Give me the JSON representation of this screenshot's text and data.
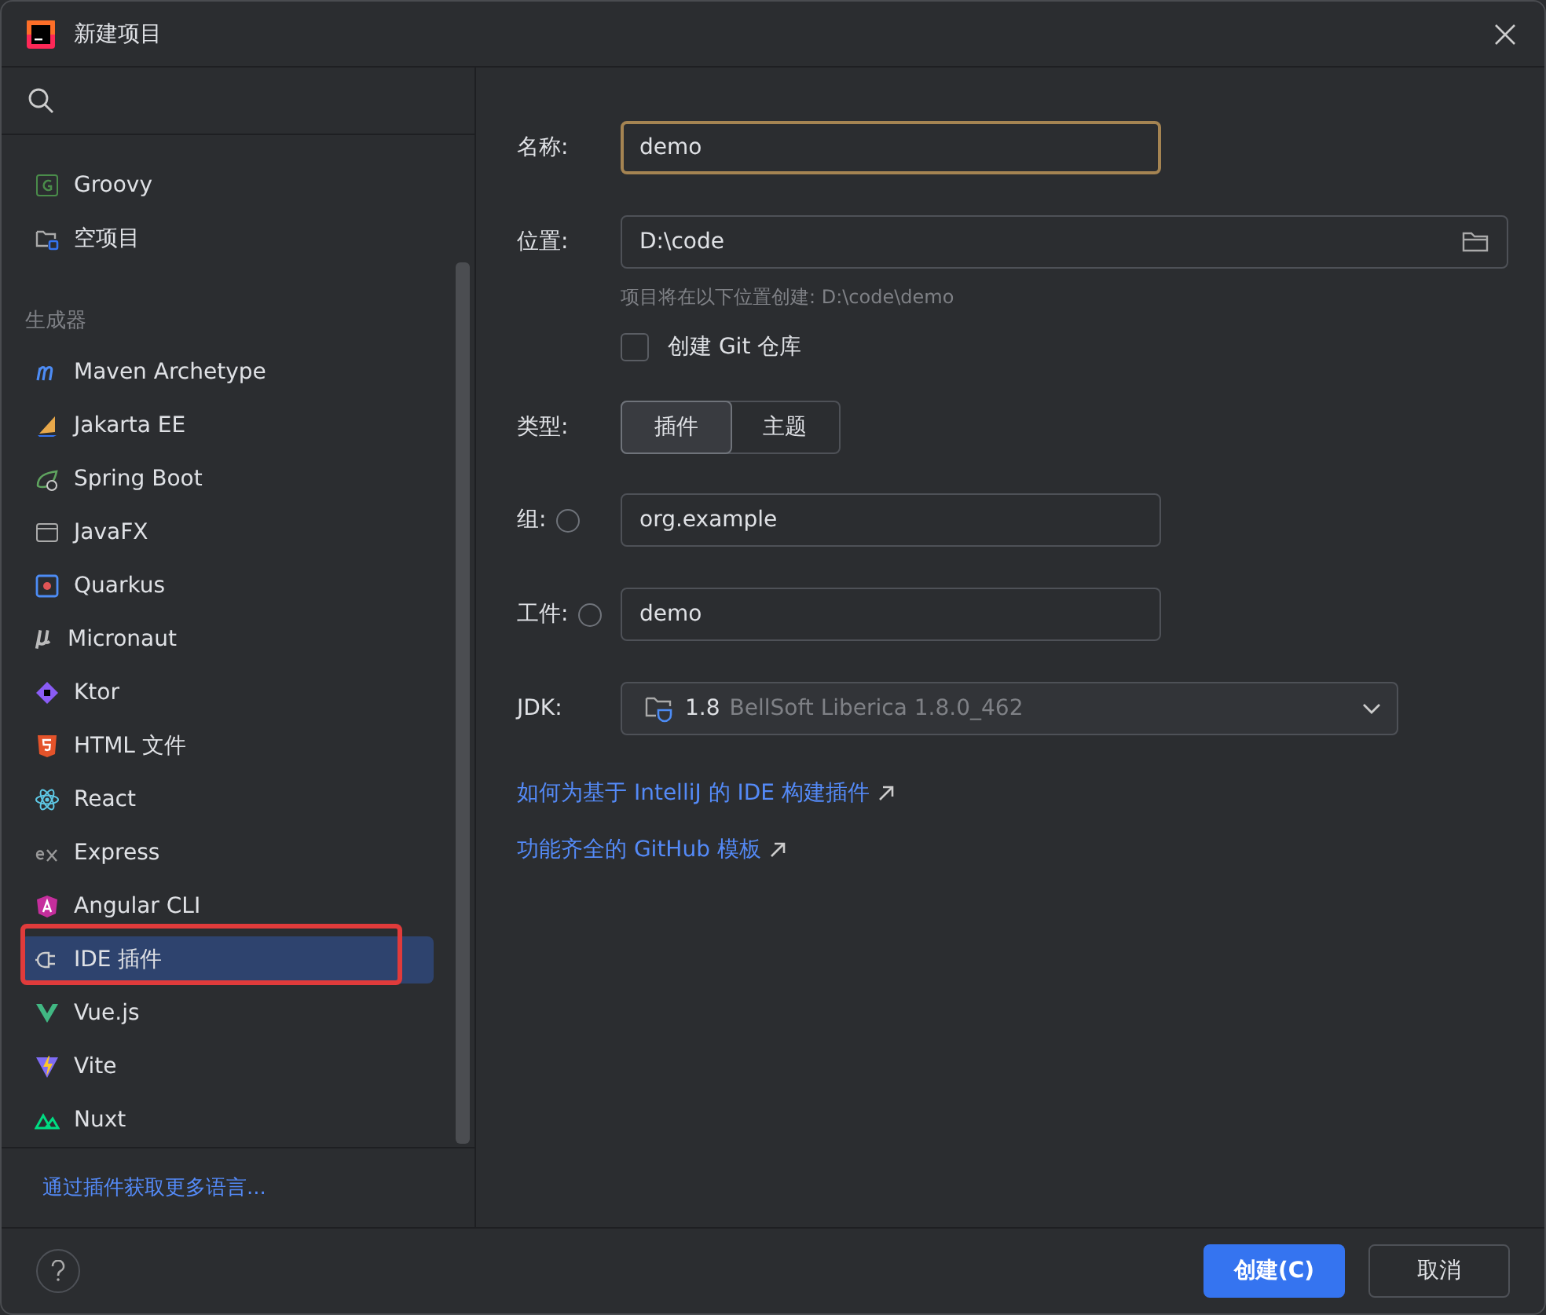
{
  "window": {
    "title": "新建项目"
  },
  "sidebar": {
    "groups": [
      {
        "items": [
          {
            "label": "Groovy",
            "selected": false
          },
          {
            "label": "空项目",
            "selected": false
          }
        ]
      },
      {
        "header": "生成器",
        "items": [
          {
            "label": "Maven Archetype",
            "selected": false
          },
          {
            "label": "Jakarta EE",
            "selected": false
          },
          {
            "label": "Spring Boot",
            "selected": false
          },
          {
            "label": "JavaFX",
            "selected": false
          },
          {
            "label": "Quarkus",
            "selected": false
          },
          {
            "label": "Micronaut",
            "selected": false
          },
          {
            "label": "Ktor",
            "selected": false
          },
          {
            "label": "HTML 文件",
            "selected": false
          },
          {
            "label": "React",
            "selected": false
          },
          {
            "label": "Express",
            "selected": false
          },
          {
            "label": "Angular CLI",
            "selected": false
          },
          {
            "label": "IDE 插件",
            "selected": true
          },
          {
            "label": "Vue.js",
            "selected": false
          },
          {
            "label": "Vite",
            "selected": false
          },
          {
            "label": "Nuxt",
            "selected": false
          }
        ]
      }
    ],
    "footer_link": "通过插件获取更多语言..."
  },
  "form": {
    "name": {
      "label": "名称:",
      "value": "demo",
      "focused": true
    },
    "location": {
      "label": "位置:",
      "value": "D:\\code",
      "hint": "项目将在以下位置创建: D:\\code\\demo"
    },
    "git": {
      "label": "创建 Git 仓库",
      "checked": false
    },
    "type": {
      "label": "类型:",
      "options": [
        {
          "label": "插件",
          "selected": true
        },
        {
          "label": "主题",
          "selected": false
        }
      ]
    },
    "group": {
      "label": "组:",
      "value": "org.example"
    },
    "artifact": {
      "label": "工件:",
      "value": "demo"
    },
    "jdk": {
      "label": "JDK:",
      "version": "1.8",
      "description": "BellSoft Liberica 1.8.0_462"
    },
    "links": [
      "如何为基于 IntelliJ 的 IDE 构建插件",
      "功能齐全的 GitHub 模板"
    ]
  },
  "buttons": {
    "create": "创建(C)",
    "cancel": "取消"
  }
}
